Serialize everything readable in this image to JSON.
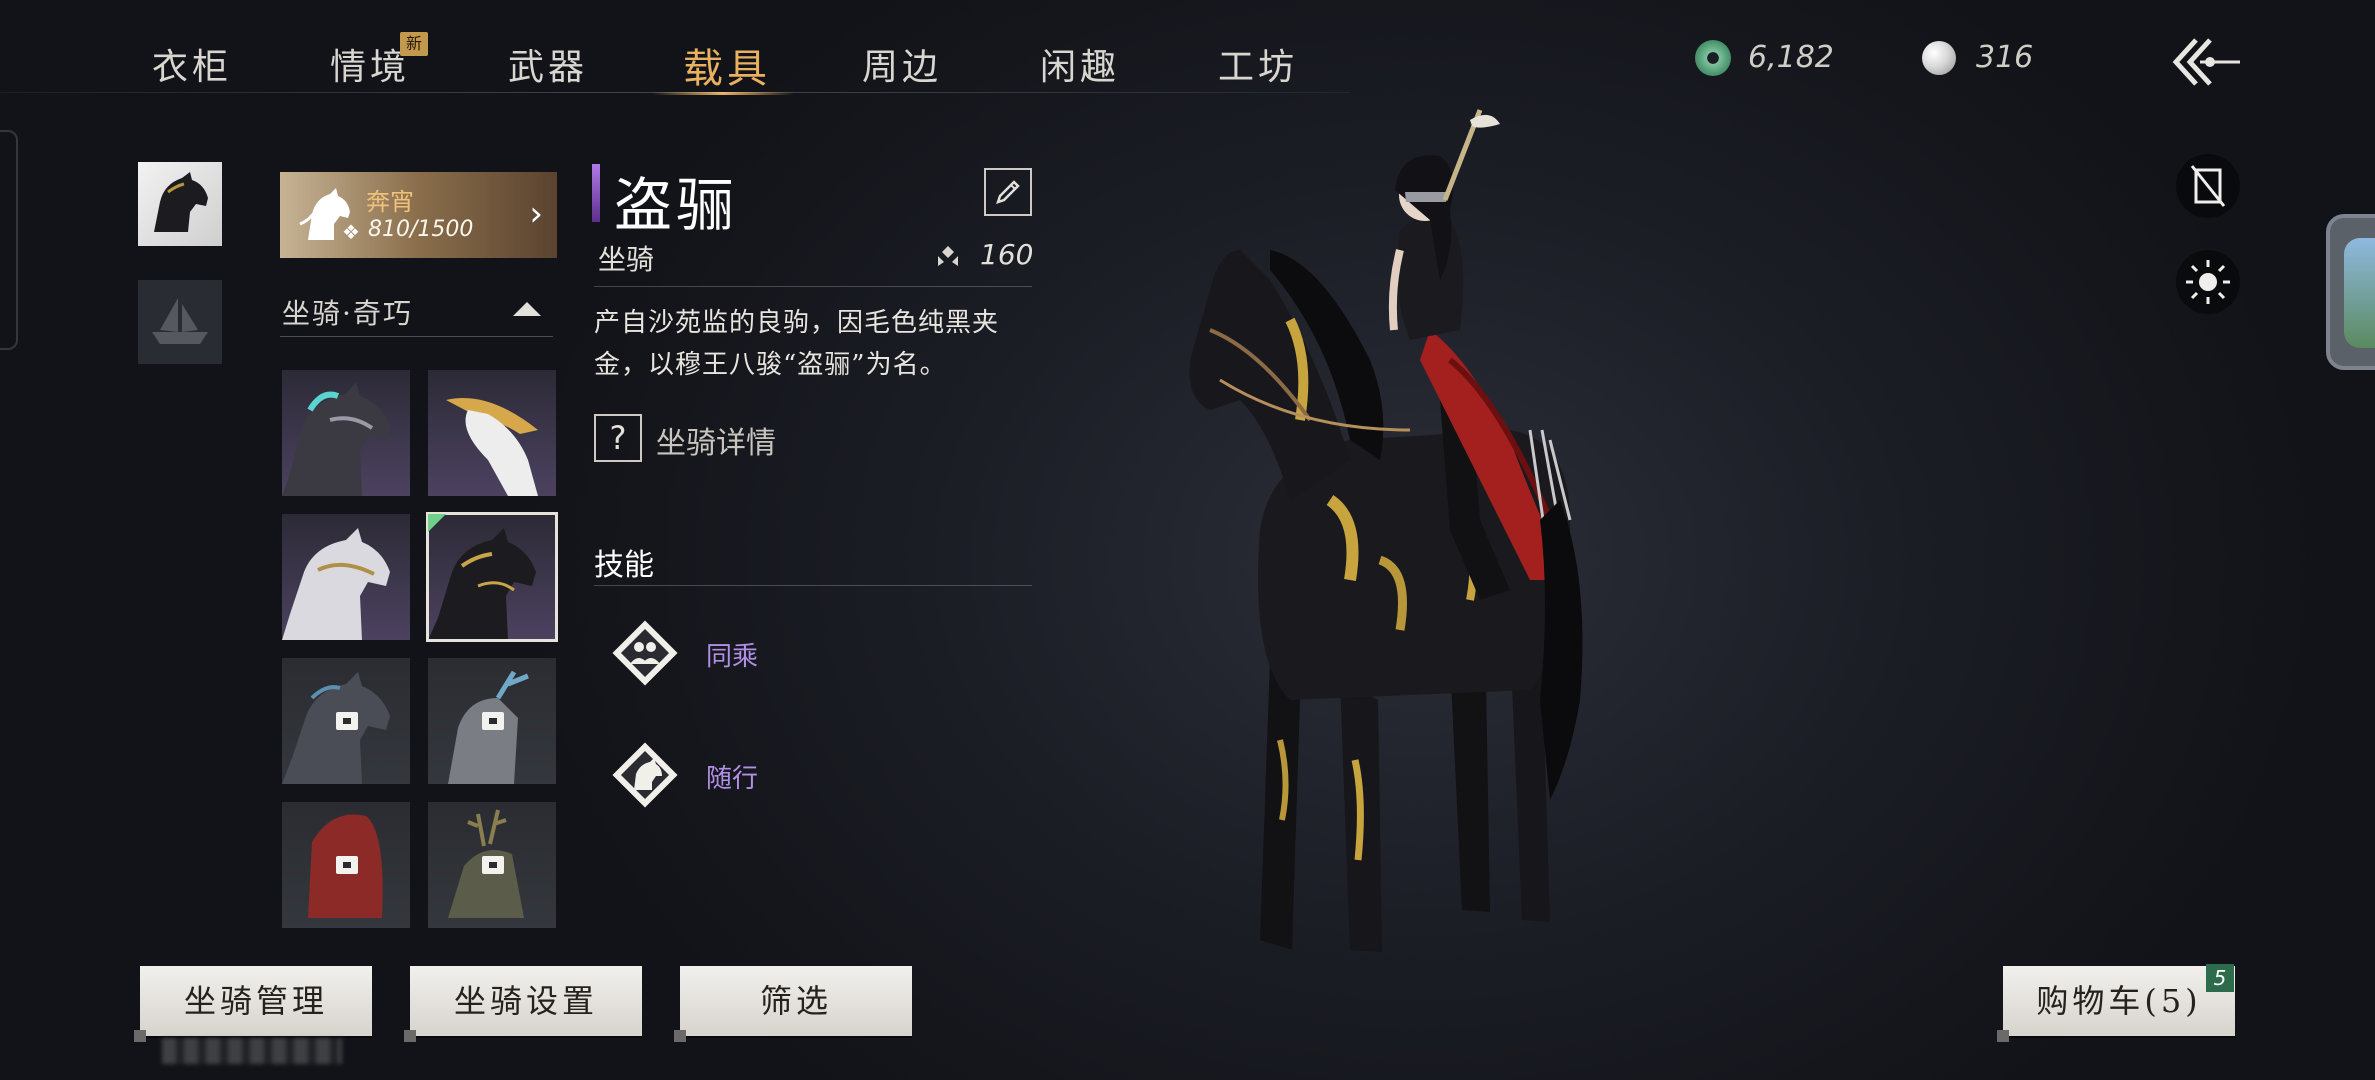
{
  "nav": {
    "tabs": [
      "衣柜",
      "情境",
      "武器",
      "载具",
      "周边",
      "闲趣",
      "工坊"
    ],
    "active": "载具",
    "new_badge": "新"
  },
  "currency": {
    "jade": "6,182",
    "pearl": "316"
  },
  "left": {
    "mount_card": {
      "name": "奔宵",
      "count": "810/1500"
    },
    "section_title": "坐骑·奇巧"
  },
  "detail": {
    "name": "盗骊",
    "type": "坐骑",
    "stat": "160",
    "description": "产自沙苑监的良驹，因毛色纯黑夹金，以穆王八骏“盗骊”为名。",
    "help_label": "坐骑详情",
    "skills_title": "技能",
    "skills": [
      {
        "icon": "tandem-riders-icon",
        "label": "同乘"
      },
      {
        "icon": "horse-follow-icon",
        "label": "随行"
      }
    ]
  },
  "buttons": {
    "manage": "坐骑管理",
    "settings": "坐骑设置",
    "filter": "筛选",
    "cart": "购物车(5)",
    "cart_count": "5"
  },
  "colors": {
    "accent_gold": "#e9b15f",
    "skill_purple": "#b18fe6",
    "title_bar_purple": "#b17ae8",
    "cart_badge_green": "#2e6a4c"
  }
}
